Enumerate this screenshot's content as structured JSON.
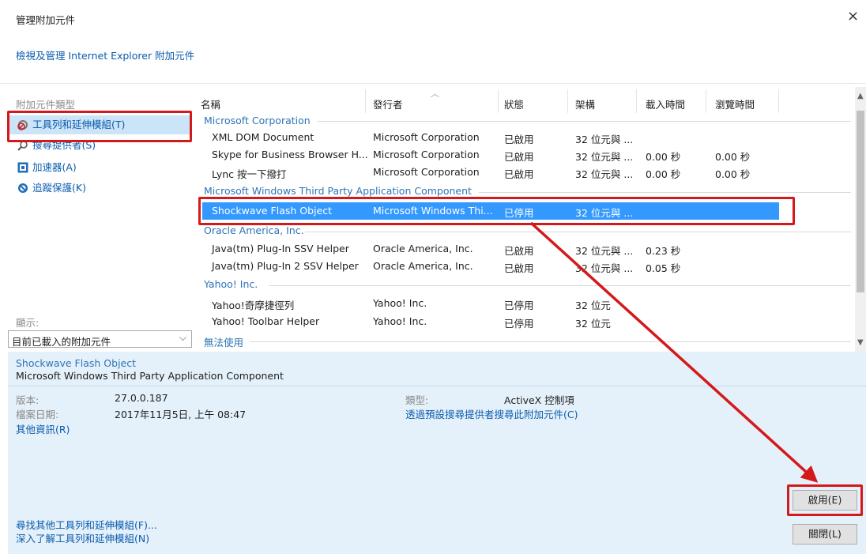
{
  "window": {
    "title": "管理附加元件",
    "close": "×"
  },
  "subtitle": "檢視及管理 Internet Explorer 附加元件",
  "sidebar": {
    "header": "附加元件類型",
    "items": [
      {
        "label": "工具列和延伸模組(T)",
        "icon": "toolbar-extensions-icon"
      },
      {
        "label": "搜尋提供者(S)",
        "icon": "search-icon"
      },
      {
        "label": "加速器(A)",
        "icon": "accelerator-icon"
      },
      {
        "label": "追蹤保護(K)",
        "icon": "tracking-protection-icon"
      }
    ],
    "show_label": "顯示:",
    "show_value": "目前已載入的附加元件"
  },
  "columns": [
    "名稱",
    "發行者",
    "狀態",
    "架構",
    "載入時間",
    "瀏覽時間"
  ],
  "groups": [
    {
      "name": "Microsoft Corporation",
      "rows": [
        {
          "name": "XML DOM Document",
          "publisher": "Microsoft Corporation",
          "status": "已啟用",
          "arch": "32 位元與 ...",
          "load": "",
          "nav": ""
        },
        {
          "name": "Skype for Business Browser H...",
          "publisher": "Microsoft Corporation",
          "status": "已啟用",
          "arch": "32 位元與 ...",
          "load": "0.00 秒",
          "nav": "0.00 秒"
        },
        {
          "name": "Lync 按一下撥打",
          "publisher": "Microsoft Corporation",
          "status": "已啟用",
          "arch": "32 位元與 ...",
          "load": "0.00 秒",
          "nav": "0.00 秒"
        }
      ]
    },
    {
      "name": "Microsoft Windows Third Party Application Component",
      "rows": [
        {
          "name": "Shockwave Flash Object",
          "publisher": "Microsoft Windows Thi...",
          "status": "已停用",
          "arch": "32 位元與 ...",
          "load": "",
          "nav": ""
        }
      ]
    },
    {
      "name": "Oracle America, Inc.",
      "rows": [
        {
          "name": "Java(tm) Plug-In SSV Helper",
          "publisher": "Oracle America, Inc.",
          "status": "已啟用",
          "arch": "32 位元與 ...",
          "load": "0.23 秒",
          "nav": ""
        },
        {
          "name": "Java(tm) Plug-In 2 SSV Helper",
          "publisher": "Oracle America, Inc.",
          "status": "已啟用",
          "arch": "32 位元與 ...",
          "load": "0.05 秒",
          "nav": ""
        }
      ]
    },
    {
      "name": "Yahoo! Inc.",
      "rows": [
        {
          "name": "Yahoo!奇摩捷徑列",
          "publisher": "Yahoo! Inc.",
          "status": "已停用",
          "arch": "32 位元",
          "load": "",
          "nav": ""
        },
        {
          "name": "Yahoo! Toolbar Helper",
          "publisher": "Yahoo! Inc.",
          "status": "已停用",
          "arch": "32 位元",
          "load": "",
          "nav": ""
        }
      ]
    },
    {
      "name": "無法使用",
      "rows": []
    }
  ],
  "detail": {
    "name": "Shockwave Flash Object",
    "publisher": "Microsoft Windows Third Party Application Component",
    "version_label": "版本:",
    "version": "27.0.0.187",
    "date_label": "檔案日期:",
    "date": "2017年11月5日, 上午 08:47",
    "more_info": "其他資訊(R)",
    "type_label": "類型:",
    "type": "ActiveX 控制項",
    "search_link": "透過預設搜尋提供者搜尋此附加元件(C)"
  },
  "footer": {
    "find_more": "尋找其他工具列和延伸模組(F)...",
    "learn_more": "深入了解工具列和延伸模組(N)",
    "enable_button": "啟用(E)",
    "close_button": "關閉(L)"
  },
  "colors": {
    "selection": "#3399ff",
    "link": "#0b5cad",
    "group": "#2e74b5",
    "annotation": "#d4191a",
    "detail_bg": "#e5f1fa"
  }
}
